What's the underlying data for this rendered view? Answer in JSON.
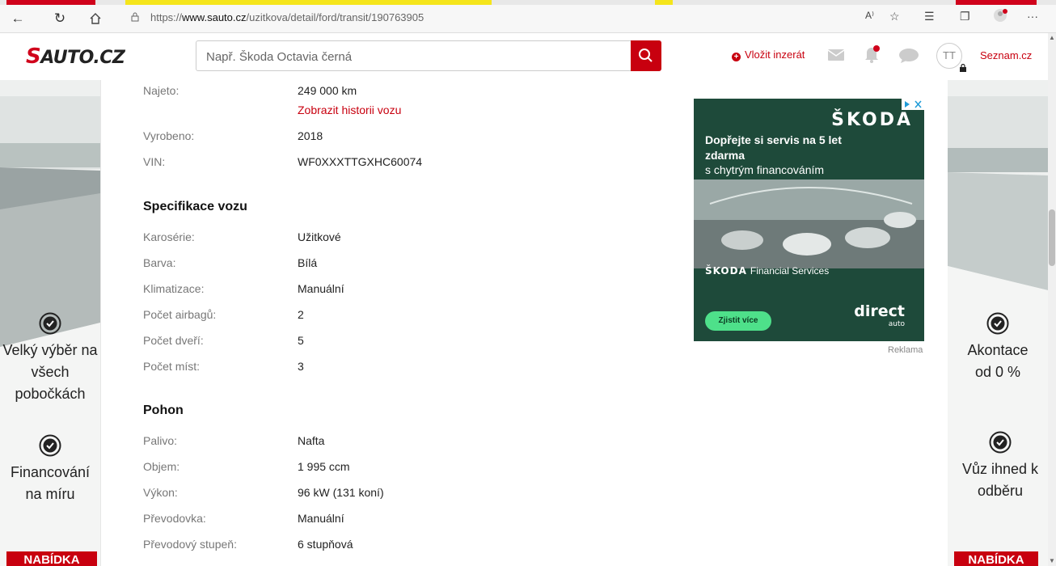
{
  "browser": {
    "url_prefix": "https://",
    "url_domain": "www.sauto.cz",
    "url_path": "/uzitkova/detail/ford/transit/190763905",
    "read_aloud_icon": "A⁾",
    "more_icon": "···"
  },
  "header": {
    "logo_s": "S",
    "logo_text": "AUTO.CZ",
    "search_placeholder": "Např. Škoda Octavia černá",
    "add_listing_label": "Vložit inzerát",
    "add_listing_plus": "+",
    "avatar_initials": "TT",
    "seznam_label": "Seznam.cz"
  },
  "left_banner": {
    "features": [
      "Velký výběr na všech pobočkách",
      "Financování na míru"
    ],
    "cta": "NABÍDKA"
  },
  "right_banner": {
    "features": [
      "Akontace od 0 %",
      "Vůz ihned k odběru"
    ],
    "cta": "NABÍDKA"
  },
  "details": {
    "mileage": {
      "label": "Najeto:",
      "value": "249 000 km",
      "history_link": "Zobrazit historii vozu"
    },
    "year": {
      "label": "Vyrobeno:",
      "value": "2018"
    },
    "vin": {
      "label": "VIN:",
      "value": "WF0XXXTTGXHC60074"
    }
  },
  "specs": {
    "title": "Specifikace vozu",
    "rows": [
      {
        "label": "Karosérie:",
        "value": "Užitkové"
      },
      {
        "label": "Barva:",
        "value": "Bílá"
      },
      {
        "label": "Klimatizace:",
        "value": "Manuální"
      },
      {
        "label": "Počet airbagů:",
        "value": "2"
      },
      {
        "label": "Počet dveří:",
        "value": "5"
      },
      {
        "label": "Počet míst:",
        "value": "3"
      }
    ]
  },
  "drive": {
    "title": "Pohon",
    "rows": [
      {
        "label": "Palivo:",
        "value": "Nafta"
      },
      {
        "label": "Objem:",
        "value": "1 995 ccm"
      },
      {
        "label": "Výkon:",
        "value": "96 kW (131 koní)"
      },
      {
        "label": "Převodovka:",
        "value": "Manuální"
      },
      {
        "label": "Převodový stupeň:",
        "value": "6 stupňová"
      }
    ]
  },
  "ad": {
    "brand": "ŠKODA",
    "headline": "Dopřejte si servis na 5 let zdarma",
    "subline": "s chytrým financováním",
    "fs_brand": "ŠKODA",
    "fs_text": "Financial Services",
    "cta": "Zjistit více",
    "direct": "direct",
    "direct_sub": "auto",
    "label": "Reklama"
  },
  "colors": {
    "brand_red": "#c8000f",
    "ad_green": "#1e4a3a",
    "cta_green": "#4ee08a"
  }
}
